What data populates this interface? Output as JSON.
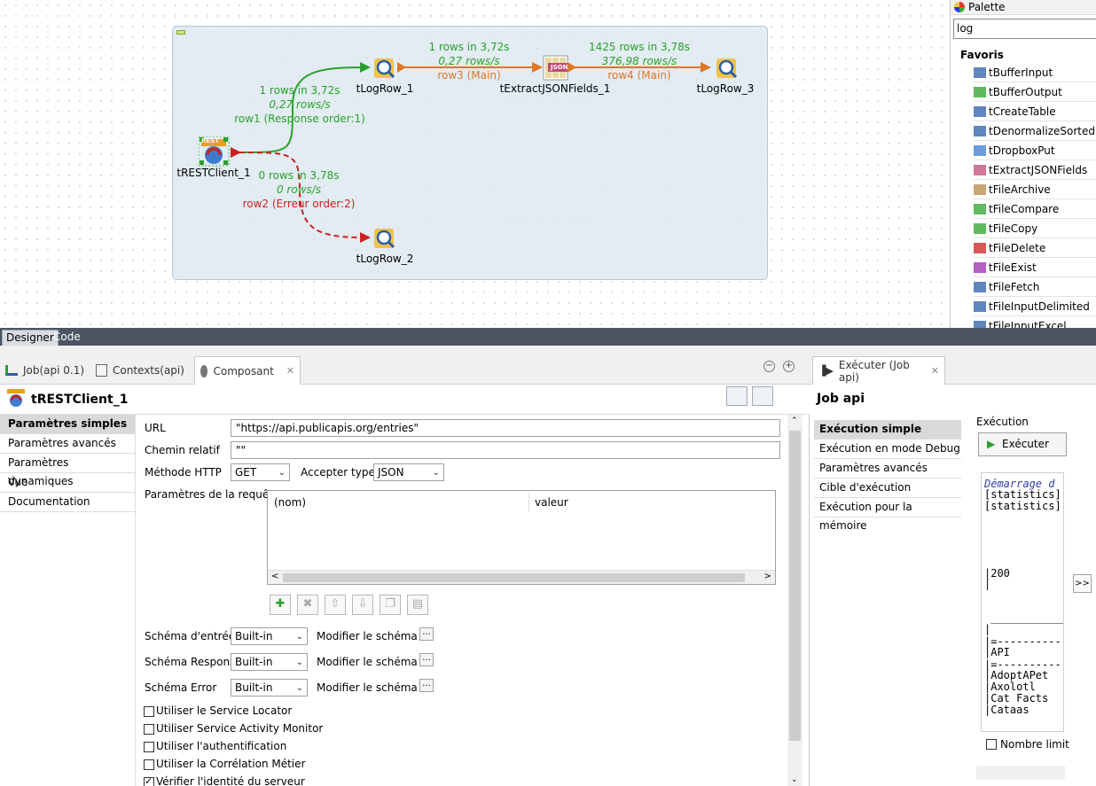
{
  "designer": {
    "components": {
      "restclient": "tRESTClient_1",
      "logrow1": "tLogRow_1",
      "extract": "tExtractJSONFields_1",
      "logrow3": "tLogRow_3",
      "logrow2": "tLogRow_2"
    },
    "flows": {
      "row1": {
        "rows": "1 rows in 3,72s",
        "rate": "0,27 rows/s",
        "name": "row1 (Response order:1)"
      },
      "row3": {
        "rows": "1 rows in 3,72s",
        "rate": "0,27 rows/s",
        "name": "row3 (Main)"
      },
      "row4": {
        "rows": "1425 rows in 3,78s",
        "rate": "376,98 rows/s",
        "name": "row4 (Main)"
      },
      "row2": {
        "rows": "0 rows in 3,78s",
        "rate": "0 rows/s",
        "name": "row2 (Erreur order:2)"
      }
    },
    "rest_badge": "REST",
    "json_badge": "JSON"
  },
  "palette": {
    "title": "Palette",
    "search_value": "log",
    "favorites_label": "Favoris",
    "items": [
      "tBufferInput",
      "tBufferOutput",
      "tCreateTable",
      "tDenormalizeSortedRow",
      "tDropboxPut",
      "tExtractJSONFields",
      "tFileArchive",
      "tFileCompare",
      "tFileCopy",
      "tFileDelete",
      "tFileExist",
      "tFileFetch",
      "tFileInputDelimited",
      "tFileInputExcel"
    ]
  },
  "editor_tabs": {
    "designer": "Designer",
    "code": "Code"
  },
  "bottom_tabs": {
    "job": "Job(api 0.1)",
    "contexts": "Contexts(api)",
    "composant": "Composant"
  },
  "component": {
    "title": "tRESTClient_1",
    "nav": [
      "Paramètres simples",
      "Paramètres avancés",
      "Paramètres dynamiques",
      "Vue",
      "Documentation"
    ],
    "url_label": "URL",
    "url_value": "\"https://api.publicapis.org/entries\"",
    "chemin_label": "Chemin relatif",
    "chemin_value": "\"\"",
    "methode_label": "Méthode HTTP",
    "methode_value": "GET",
    "accept_label": "Accepter type",
    "accept_value": "JSON",
    "params_label": "Paramètres de la requête",
    "params_cols": [
      "(nom)",
      "valeur"
    ],
    "schema_rows": [
      {
        "label": "Schéma d'entrée",
        "value": "Built-in",
        "modify": "Modifier le schéma"
      },
      {
        "label": "Schéma Response",
        "value": "Built-in",
        "modify": "Modifier le schéma"
      },
      {
        "label": "Schéma Error",
        "value": "Built-in",
        "modify": "Modifier le schéma"
      }
    ],
    "checkboxes": [
      {
        "label": "Utiliser le Service Locator",
        "checked": false
      },
      {
        "label": "Utiliser Service Activity Monitor",
        "checked": false
      },
      {
        "label": "Utiliser l'authentification",
        "checked": false
      },
      {
        "label": "Utiliser la Corrélation Métier",
        "checked": false
      },
      {
        "label": "Vérifier l'identité du serveur",
        "checked": true
      }
    ]
  },
  "run_panel": {
    "tab": "Exécuter (Job api)",
    "title": "Job api",
    "nav": [
      "Exécution simple",
      "Exécution en mode Debug",
      "Paramètres avancés",
      "Cible d'exécution",
      "Exécution pour la mémoire"
    ],
    "exec_label": "Exécution",
    "exec_button": "Exécuter",
    "console": [
      {
        "text": "Démarrage d",
        "color": "#3040a0",
        "italic": true
      },
      {
        "text": "[statistics]",
        "color": "#000",
        "italic": false
      },
      {
        "text": "[statistics]",
        "color": "#000",
        "italic": false
      },
      {
        "text": "|200",
        "color": "#000",
        "italic": false
      },
      {
        "text": "|",
        "color": "#000",
        "italic": false
      },
      {
        "text": " ____________",
        "color": "#000",
        "italic": false
      },
      {
        "text": "|",
        "color": "#000",
        "italic": false
      },
      {
        "text": "|=-----------",
        "color": "#000",
        "italic": false
      },
      {
        "text": "|API",
        "color": "#000",
        "italic": false
      },
      {
        "text": "|=-----------",
        "color": "#000",
        "italic": false
      },
      {
        "text": "|AdoptAPet",
        "color": "#000",
        "italic": false
      },
      {
        "text": "|Axolotl",
        "color": "#000",
        "italic": false
      },
      {
        "text": "|Cat Facts",
        "color": "#000",
        "italic": false
      },
      {
        "text": "|Cataas",
        "color": "#000",
        "italic": false
      }
    ],
    "limit_label": "Nombre limit",
    "expand": ">>"
  }
}
